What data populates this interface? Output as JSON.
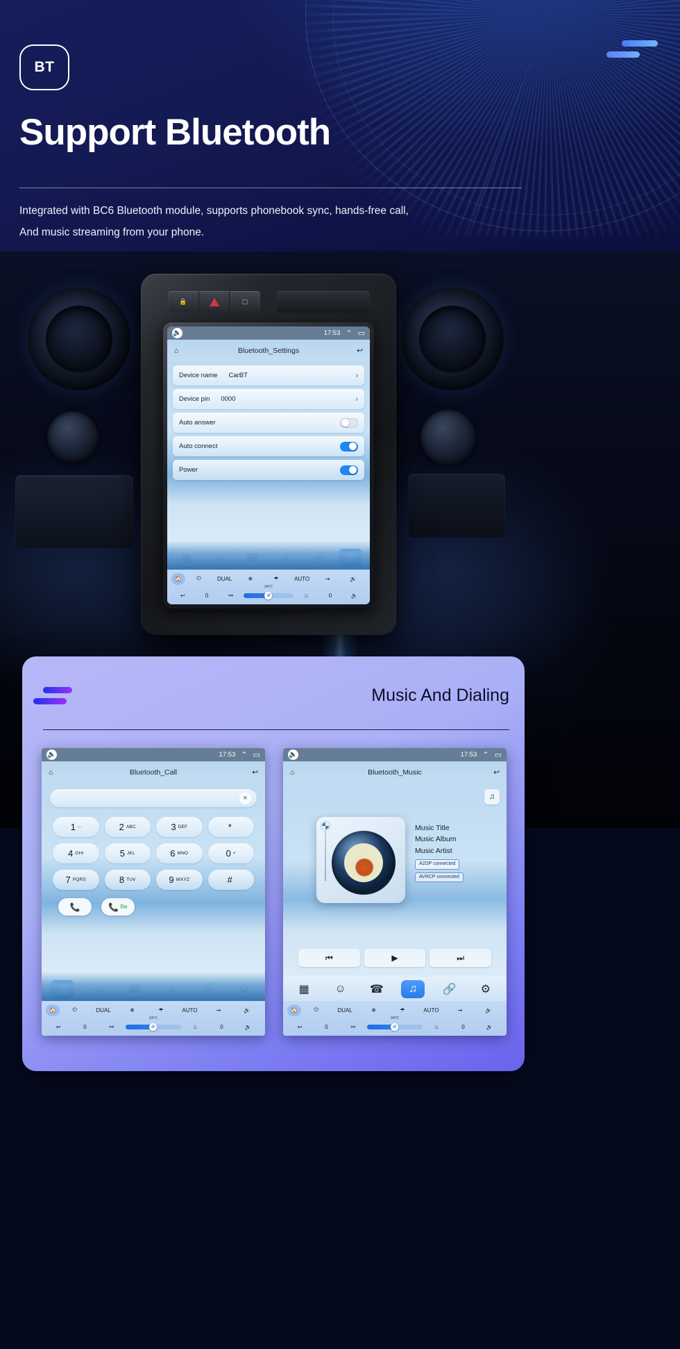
{
  "hero": {
    "badge": "BT",
    "title": "Support Bluetooth",
    "subtitle_line1": "Integrated with BC6 Bluetooth module, supports phonebook sync, hands-free call,",
    "subtitle_line2": "And music streaming from your phone.",
    "menu_icon": "hamburger-icon"
  },
  "settings_screen": {
    "statusbar": {
      "volume_icon": "volume-icon",
      "time": "17:53",
      "up_icon": "⌃",
      "recents_icon": "▭"
    },
    "home_icon": "home-icon",
    "title": "Bluetooth_Settings",
    "back_icon": "↩",
    "rows": [
      {
        "label": "Device name",
        "value": "CarBT",
        "control": "chevron"
      },
      {
        "label": "Device pin",
        "value": "0000",
        "control": "chevron"
      },
      {
        "label": "Auto answer",
        "value": "",
        "control": "toggle-off"
      },
      {
        "label": "Auto connect",
        "value": "",
        "control": "toggle-on"
      },
      {
        "label": "Power",
        "value": "",
        "control": "toggle-on"
      }
    ],
    "dock": [
      {
        "icon": "apps-grid-icon",
        "active": false
      },
      {
        "icon": "contacts-icon",
        "active": false
      },
      {
        "icon": "phone-icon",
        "active": false
      },
      {
        "icon": "music-icon",
        "active": false
      },
      {
        "icon": "link-icon",
        "active": false
      },
      {
        "icon": "settings-icon",
        "active": true
      }
    ],
    "climate": {
      "home_icon": "home-icon",
      "power_icon": "power-icon",
      "dual_label": "DUAL",
      "snow_icon": "snowflake-icon",
      "defrost_icon": "defrost-icon",
      "auto_label": "AUTO",
      "recirc_icon": "recirculate-icon",
      "vol_up_icon": "volume-up-icon",
      "temperature": "24°C",
      "back_icon": "back-arrow-icon",
      "left_value": "0",
      "seat_icon": "seat-icon",
      "seat_heat_icon": "seat-heat-icon",
      "right_value": "0",
      "vol_down_icon": "volume-down-icon"
    }
  },
  "card": {
    "title": "Music And Dialing",
    "menu_icon": "hamburger-icon"
  },
  "call_screen": {
    "statusbar": {
      "volume_icon": "volume-icon",
      "time": "17:53",
      "up_icon": "⌃",
      "recents_icon": "▭"
    },
    "home_icon": "home-icon",
    "title": "Bluetooth_Call",
    "back_icon": "↩",
    "input_value": "",
    "clear_icon": "×",
    "keys": [
      {
        "num": "1",
        "sub": "--"
      },
      {
        "num": "2",
        "sub": "ABC"
      },
      {
        "num": "3",
        "sub": "DEF"
      },
      {
        "num": "*",
        "sub": ""
      },
      {
        "num": "4",
        "sub": "GHI"
      },
      {
        "num": "5",
        "sub": "JKL"
      },
      {
        "num": "6",
        "sub": "MNO"
      },
      {
        "num": "0",
        "sub": "+"
      },
      {
        "num": "7",
        "sub": "PQRS"
      },
      {
        "num": "8",
        "sub": "TUV"
      },
      {
        "num": "9",
        "sub": "WXYZ"
      },
      {
        "num": "#",
        "sub": ""
      }
    ],
    "call_button_icon": "call-icon",
    "redial_button_icon": "call-icon",
    "redial_label": "Re",
    "dock": [
      {
        "icon": "apps-grid-icon",
        "active": true
      },
      {
        "icon": "contacts-icon",
        "active": false
      },
      {
        "icon": "phone-icon",
        "active": false
      },
      {
        "icon": "music-icon",
        "active": false
      },
      {
        "icon": "link-icon",
        "active": false
      },
      {
        "icon": "settings-icon",
        "active": false
      }
    ],
    "climate": {
      "home_icon": "home-icon",
      "power_icon": "power-icon",
      "dual_label": "DUAL",
      "snow_icon": "snowflake-icon",
      "defrost_icon": "defrost-icon",
      "auto_label": "AUTO",
      "recirc_icon": "recirculate-icon",
      "vol_up_icon": "volume-up-icon",
      "temperature": "24°C",
      "back_icon": "back-arrow-icon",
      "left_value": "0",
      "right_value": "0",
      "vol_down_icon": "volume-down-icon"
    }
  },
  "music_screen": {
    "statusbar": {
      "volume_icon": "volume-icon",
      "time": "17:53",
      "up_icon": "⌃",
      "recents_icon": "▭"
    },
    "home_icon": "home-icon",
    "title": "Bluetooth_Music",
    "back_icon": "↩",
    "list_icon": "music-list-icon",
    "meta": {
      "title": "Music Title",
      "album": "Music Album",
      "artist": "Music Artist",
      "a2dp": "A2DP  connected",
      "avrcp": "AVRCP connected"
    },
    "transport": {
      "prev_icon": "⏮",
      "play_icon": "▶",
      "next_icon": "⏭"
    },
    "dock": [
      {
        "icon": "apps-grid-icon",
        "active": false
      },
      {
        "icon": "contacts-icon",
        "active": false
      },
      {
        "icon": "phone-icon",
        "active": false
      },
      {
        "icon": "music-icon",
        "active": true
      },
      {
        "icon": "link-icon",
        "active": false
      },
      {
        "icon": "settings-icon",
        "active": false
      }
    ],
    "climate": {
      "home_icon": "home-icon",
      "power_icon": "power-icon",
      "dual_label": "DUAL",
      "snow_icon": "snowflake-icon",
      "defrost_icon": "defrost-icon",
      "auto_label": "AUTO",
      "recirc_icon": "recirculate-icon",
      "vol_up_icon": "volume-up-icon",
      "temperature": "24°C",
      "back_icon": "back-arrow-icon",
      "left_value": "0",
      "right_value": "0",
      "vol_down_icon": "volume-down-icon"
    }
  },
  "colors": {
    "hero_bg": "#141a52",
    "accent_blue": "#2b7ae8",
    "card_purple": "#aab0f6",
    "toggle_on": "#1f86f5"
  }
}
